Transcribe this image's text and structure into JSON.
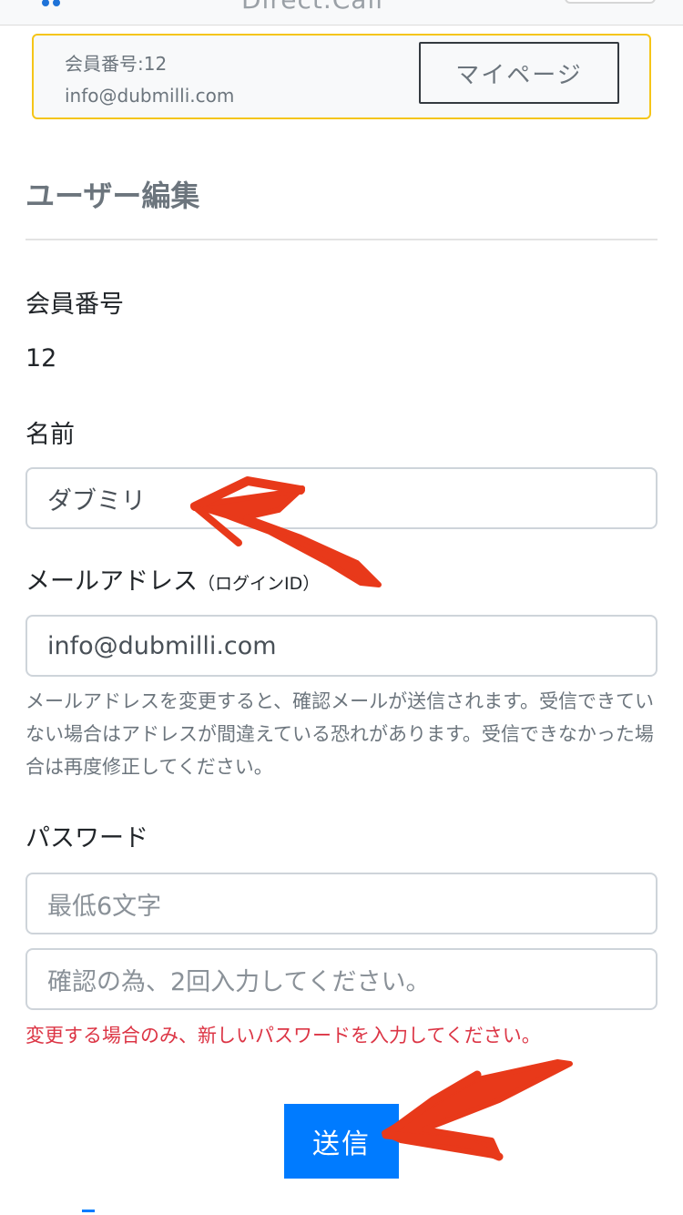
{
  "navbar": {
    "brand": "Direct.Cali"
  },
  "member_card": {
    "number_label": "会員番号:12",
    "email": "info@dubmilli.com",
    "mypage_button": "マイページ"
  },
  "page_title": "ユーザー編集",
  "form": {
    "member_number": {
      "label": "会員番号",
      "value": "12"
    },
    "name": {
      "label": "名前",
      "value": "ダブミリ"
    },
    "email": {
      "label": "メールアドレス",
      "label_note": "（ログインID）",
      "value": "info@dubmilli.com",
      "help": "メールアドレスを変更すると、確認メールが送信されます。受信できていない場合はアドレスが間違えている恐れがあります。受信できなかった場合は再度修正してください。"
    },
    "password": {
      "label": "パスワード",
      "placeholder": "最低6文字",
      "confirm_placeholder": "確認の為、2回入力してください。",
      "warning": "変更する場合のみ、新しいパスワードを入力してください。"
    },
    "submit_label": "送信"
  },
  "colors": {
    "primary": "#007bff",
    "warning_text": "#dc3545",
    "card_border": "#f5c518",
    "annotation_arrow": "#e8391a"
  },
  "icons": [
    "arrow-annotation-icon"
  ]
}
